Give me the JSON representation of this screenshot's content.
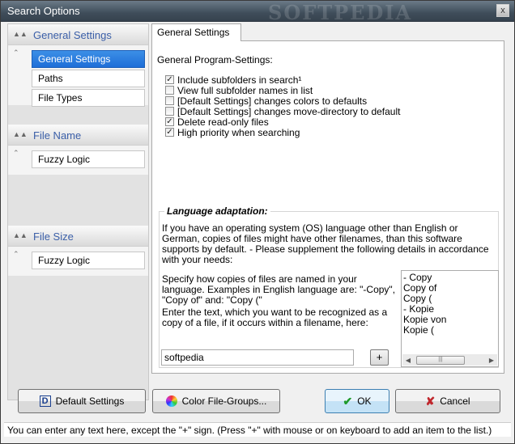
{
  "window": {
    "title": "Search Options",
    "watermark": "SOFTPEDIA",
    "close_label": "x"
  },
  "sidebar": {
    "sections": [
      {
        "label": "General Settings",
        "items": [
          "General Settings",
          "Paths",
          "File Types"
        ]
      },
      {
        "label": "File Name",
        "items": [
          "Fuzzy Logic"
        ]
      },
      {
        "label": "File Size",
        "items": [
          "Fuzzy Logic"
        ]
      }
    ]
  },
  "tab": {
    "label": "General Settings"
  },
  "general": {
    "heading": "General Program-Settings:",
    "options": [
      {
        "label": "Include subfolders in search¹",
        "checked": true
      },
      {
        "label": "View full subfolder names in list",
        "checked": false
      },
      {
        "label": "[Default Settings] changes colors to defaults",
        "checked": false
      },
      {
        "label": "[Default Settings] changes move-directory to default",
        "checked": false
      },
      {
        "label": "Delete read-only files",
        "checked": true
      },
      {
        "label": "High priority when searching",
        "checked": true
      }
    ]
  },
  "language": {
    "title": "Language adaptation:",
    "description": "If you have an operating system (OS) language other than English or German, copies of files might have other filenames, than this software supports by default. - Please supplement the following details in accordance with your needs:",
    "specify": "Specify how copies of files are named in your language. Examples in English language are: \"-Copy\", \"Copy of\" and: \"Copy (\"",
    "enter": "Enter the text, which you want to be recognized as a copy of a file, if it occurs within a filename, here:",
    "input_value": "softpedia",
    "add_label": "+",
    "copy_list": [
      "- Copy",
      "Copy of",
      "Copy (",
      "- Kopie",
      "Kopie von",
      "Kopie ("
    ]
  },
  "buttons": {
    "default_settings": "Default Settings",
    "color_groups": "Color File-Groups...",
    "ok": "OK",
    "cancel": "Cancel"
  },
  "status": "You can enter any text here, except the \"+\" sign. (Press \"+\" with mouse or on keyboard to add an item to the list.)",
  "colors": {
    "accent": "#3b5fa8",
    "selected": "#1e6ed8",
    "ok_icon": "#1f9a2c",
    "cancel_icon": "#c0272d"
  }
}
